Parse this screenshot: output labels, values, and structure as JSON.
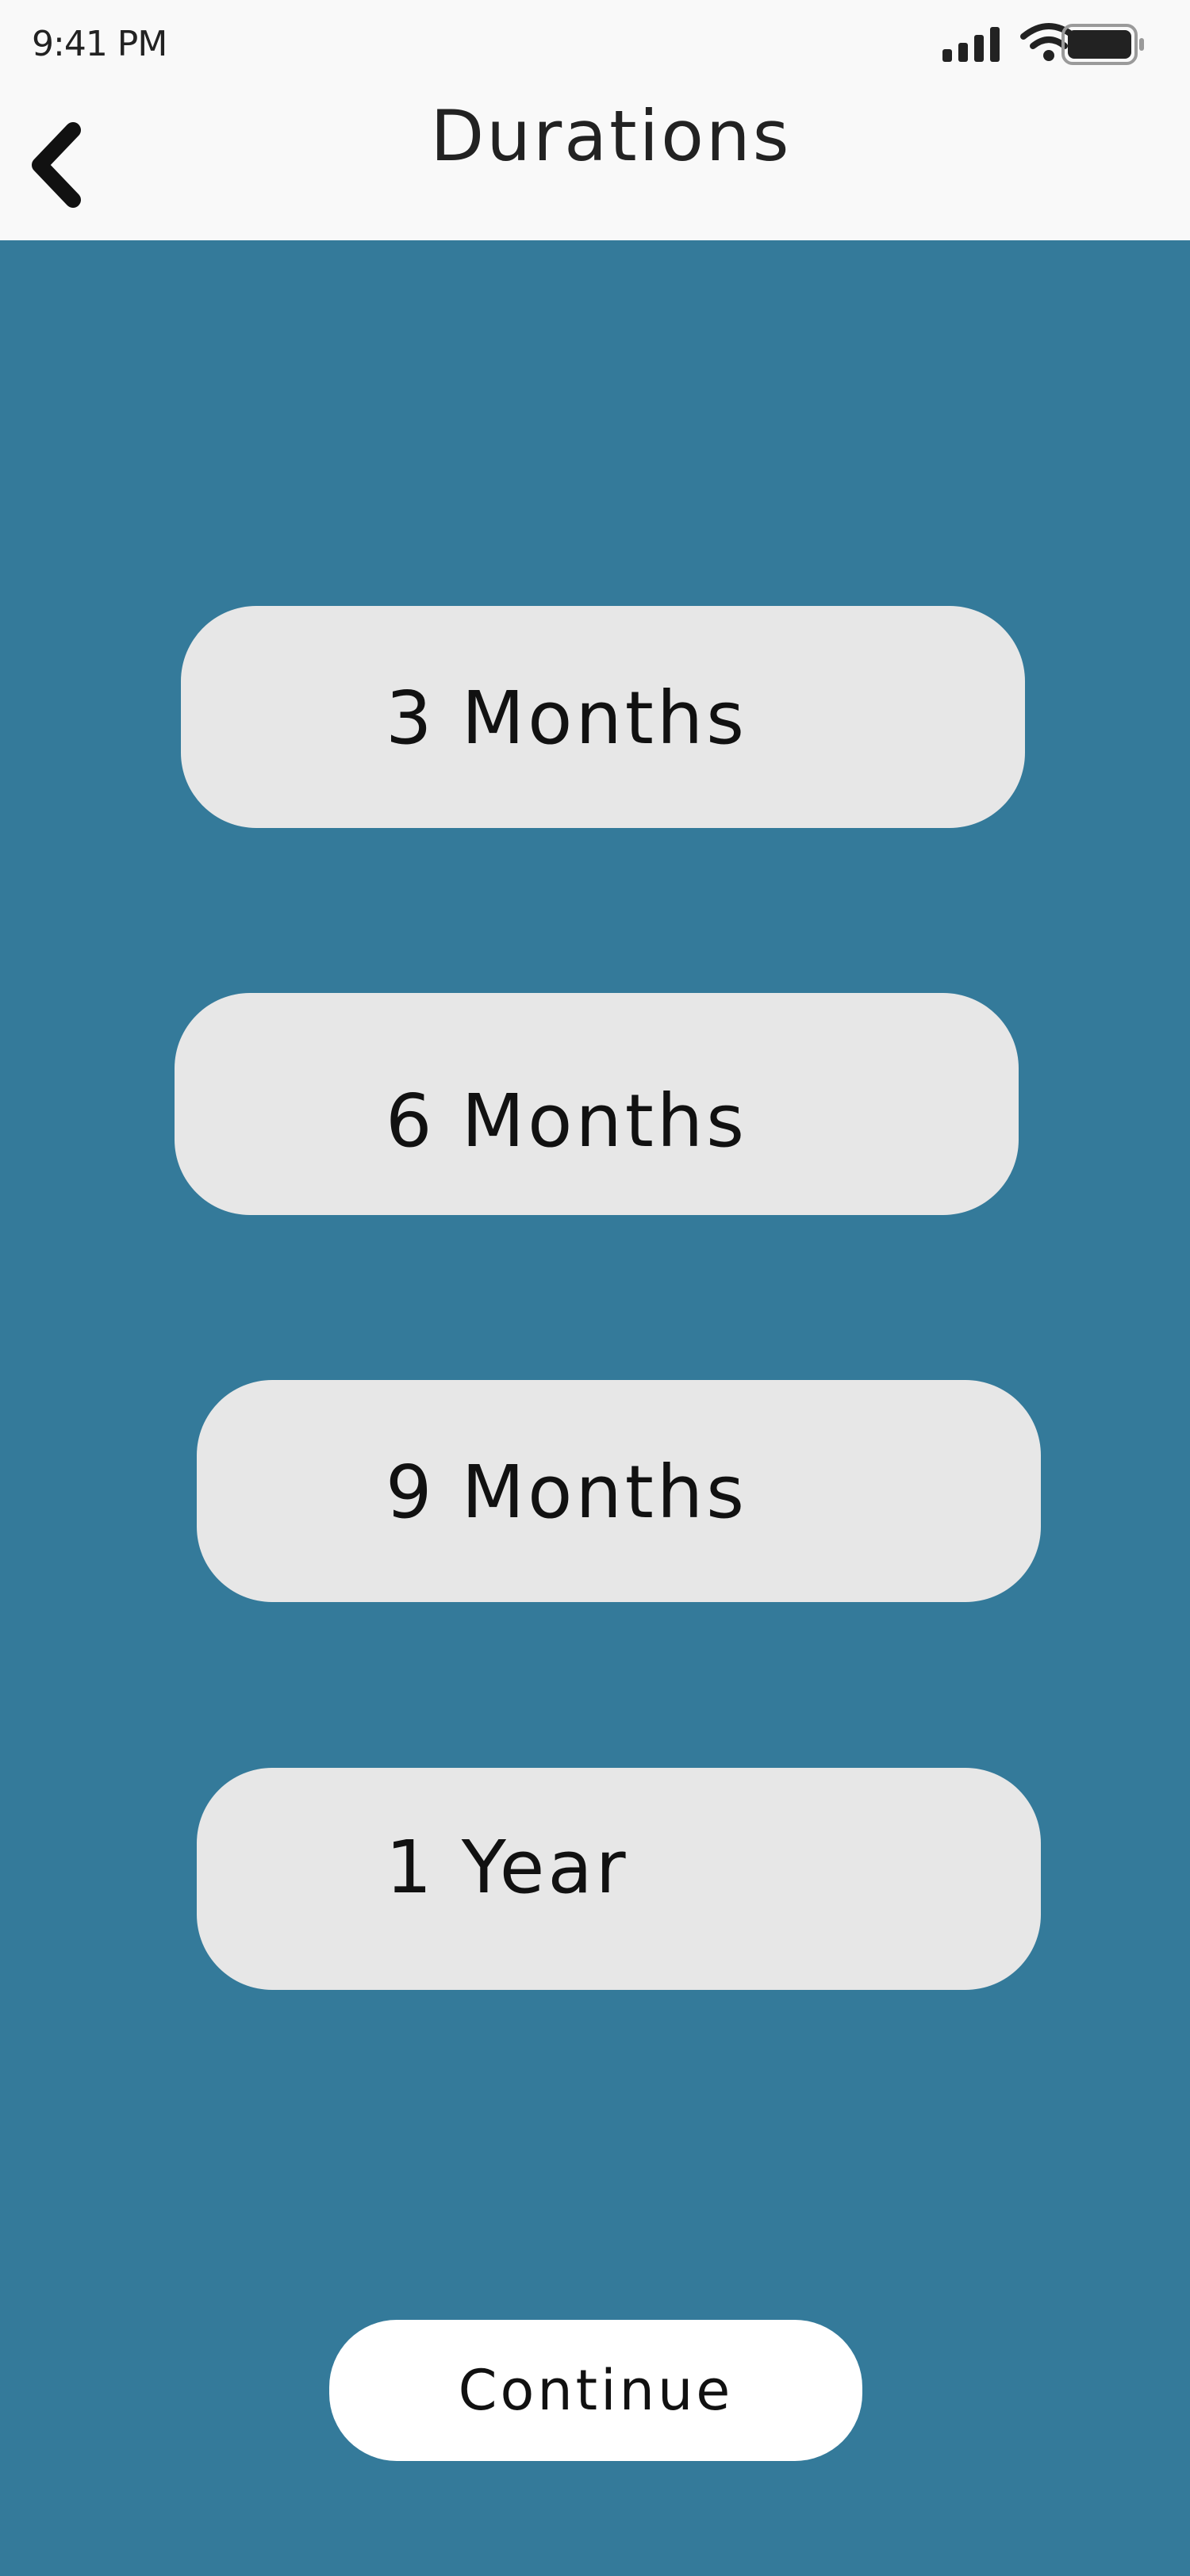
{
  "status_bar": {
    "time": "9:41 PM",
    "icons": [
      "signal-icon",
      "wifi-icon",
      "battery-icon"
    ]
  },
  "header": {
    "title": "Durations",
    "back_icon": "chevron-left-icon"
  },
  "options": [
    {
      "label": "3 Months"
    },
    {
      "label": "6 Months"
    },
    {
      "label": "9 Months"
    },
    {
      "label": "1 Year"
    }
  ],
  "continue_label": "Continue",
  "colors": {
    "background": "#347a9a",
    "header": "#f9f9f9",
    "option": "#e7e7e7",
    "button": "#ffffff"
  }
}
